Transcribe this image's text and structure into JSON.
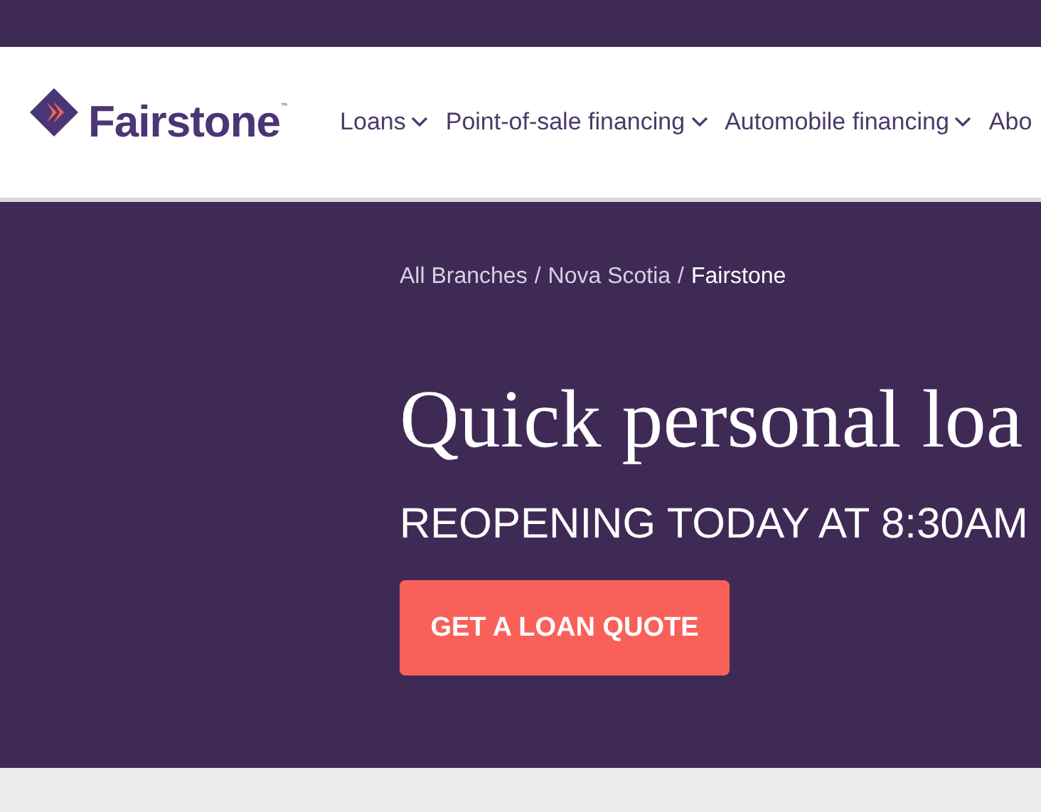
{
  "logo": {
    "name": "Fairstone",
    "mark": "™"
  },
  "nav": [
    {
      "label": "Loans",
      "dropdown": true
    },
    {
      "label": "Point-of-sale financing",
      "dropdown": true
    },
    {
      "label": "Automobile financing",
      "dropdown": true
    },
    {
      "label": "Abo",
      "dropdown": false
    }
  ],
  "breadcrumb": [
    {
      "label": "All Branches",
      "current": false
    },
    {
      "label": "Nova Scotia",
      "current": false
    },
    {
      "label": "Fairstone",
      "current": true
    }
  ],
  "breadcrumb_separator": "/",
  "hero": {
    "title": "Quick personal loa",
    "status": "REOPENING TODAY AT 8:30AM",
    "button": "GET A LOAN QUOTE"
  }
}
